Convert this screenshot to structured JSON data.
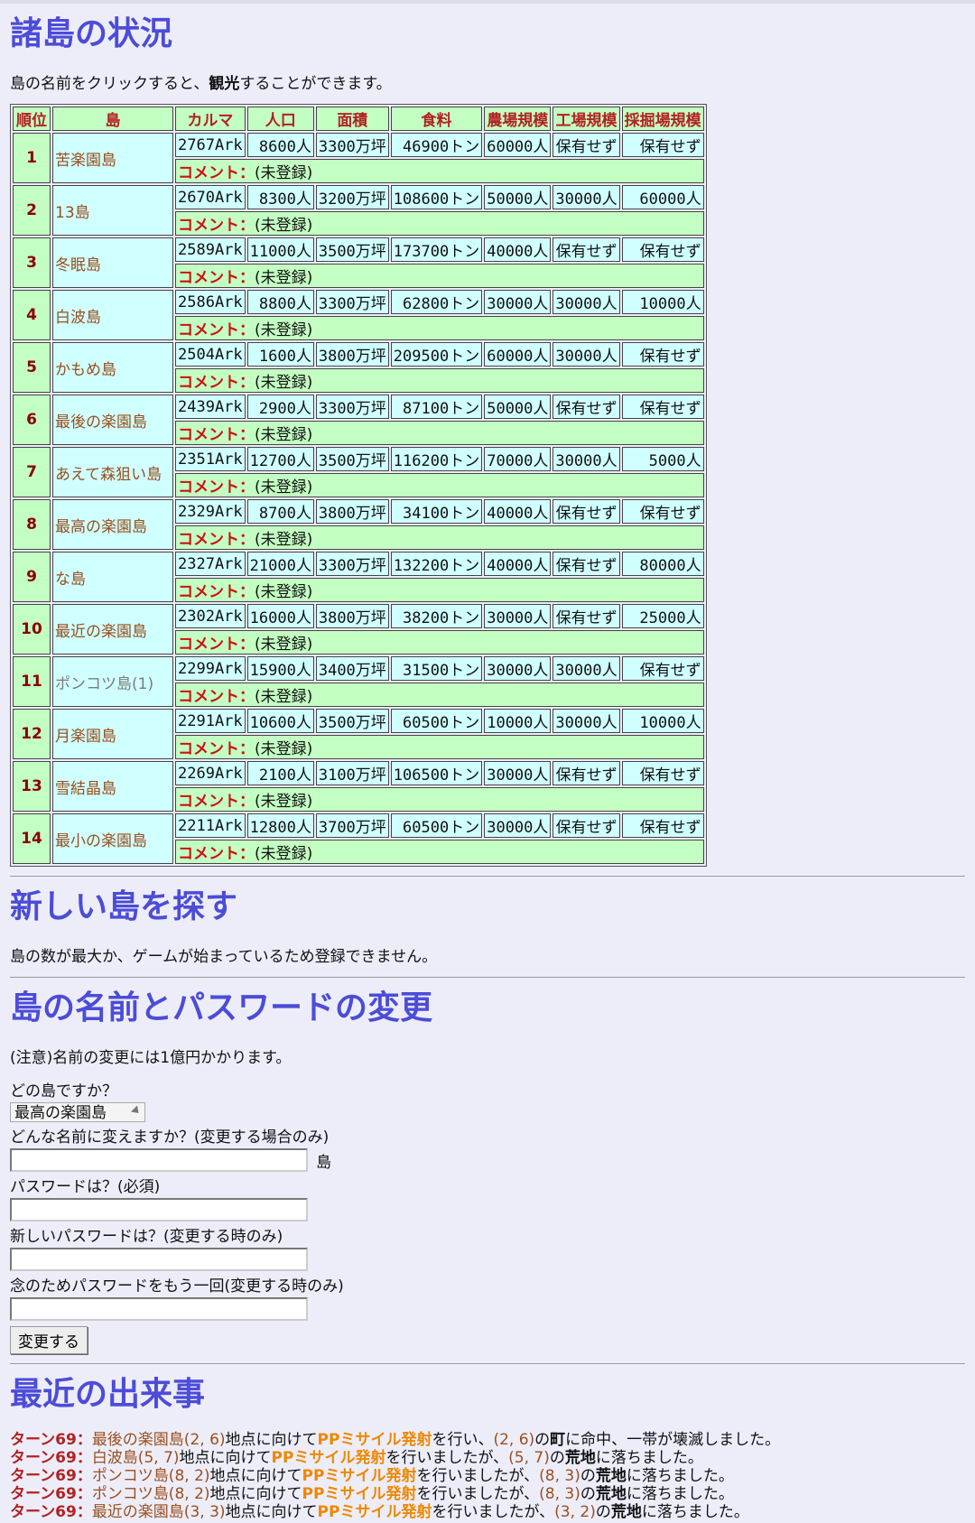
{
  "status": {
    "title": "諸島の状況",
    "note_pre": "島の名前をクリックすると、",
    "note_bold": "観光",
    "note_post": "することができます。",
    "headers": [
      "順位",
      "島",
      "カルマ",
      "人口",
      "面積",
      "食料",
      "農場規模",
      "工場規模",
      "採掘場規模"
    ],
    "comment_label": "コメント：",
    "rows": [
      {
        "rank": "1",
        "name": "苦楽園島",
        "karma": "2767Ark",
        "pop": "8600人",
        "area": "3300万坪",
        "food": "46900トン",
        "farm": "60000人",
        "factory": "保有せず",
        "mine": "保有せず",
        "comment": "(未登録)"
      },
      {
        "rank": "2",
        "name": "13島",
        "karma": "2670Ark",
        "pop": "8300人",
        "area": "3200万坪",
        "food": "108600トン",
        "farm": "50000人",
        "factory": "30000人",
        "mine": "60000人",
        "comment": "(未登録)"
      },
      {
        "rank": "3",
        "name": "冬眠島",
        "karma": "2589Ark",
        "pop": "11000人",
        "area": "3500万坪",
        "food": "173700トン",
        "farm": "40000人",
        "factory": "保有せず",
        "mine": "保有せず",
        "comment": "(未登録)"
      },
      {
        "rank": "4",
        "name": "白波島",
        "karma": "2586Ark",
        "pop": "8800人",
        "area": "3300万坪",
        "food": "62800トン",
        "farm": "30000人",
        "factory": "30000人",
        "mine": "10000人",
        "comment": "(未登録)"
      },
      {
        "rank": "5",
        "name": "かもめ島",
        "karma": "2504Ark",
        "pop": "1600人",
        "area": "3800万坪",
        "food": "209500トン",
        "farm": "60000人",
        "factory": "30000人",
        "mine": "保有せず",
        "comment": "(未登録)"
      },
      {
        "rank": "6",
        "name": "最後の楽園島",
        "karma": "2439Ark",
        "pop": "2900人",
        "area": "3300万坪",
        "food": "87100トン",
        "farm": "50000人",
        "factory": "保有せず",
        "mine": "保有せず",
        "comment": "(未登録)"
      },
      {
        "rank": "7",
        "name": "あえて森狙い島",
        "karma": "2351Ark",
        "pop": "12700人",
        "area": "3500万坪",
        "food": "116200トン",
        "farm": "70000人",
        "factory": "30000人",
        "mine": "5000人",
        "comment": "(未登録)"
      },
      {
        "rank": "8",
        "name": "最高の楽園島",
        "karma": "2329Ark",
        "pop": "8700人",
        "area": "3800万坪",
        "food": "34100トン",
        "farm": "40000人",
        "factory": "保有せず",
        "mine": "保有せず",
        "comment": "(未登録)"
      },
      {
        "rank": "9",
        "name": "な島",
        "karma": "2327Ark",
        "pop": "21000人",
        "area": "3300万坪",
        "food": "132200トン",
        "farm": "40000人",
        "factory": "保有せず",
        "mine": "80000人",
        "comment": "(未登録)"
      },
      {
        "rank": "10",
        "name": "最近の楽園島",
        "karma": "2302Ark",
        "pop": "16000人",
        "area": "3800万坪",
        "food": "38200トン",
        "farm": "30000人",
        "factory": "保有せず",
        "mine": "25000人",
        "comment": "(未登録)"
      },
      {
        "rank": "11",
        "name": "ポンコツ島(1)",
        "karma": "2299Ark",
        "pop": "15900人",
        "area": "3400万坪",
        "food": "31500トン",
        "farm": "30000人",
        "factory": "30000人",
        "mine": "保有せず",
        "comment": "(未登録)"
      },
      {
        "rank": "12",
        "name": "月楽園島",
        "karma": "2291Ark",
        "pop": "10600人",
        "area": "3500万坪",
        "food": "60500トン",
        "farm": "10000人",
        "factory": "30000人",
        "mine": "10000人",
        "comment": "(未登録)"
      },
      {
        "rank": "13",
        "name": "雪結晶島",
        "karma": "2269Ark",
        "pop": "2100人",
        "area": "3100万坪",
        "food": "106500トン",
        "farm": "30000人",
        "factory": "保有せず",
        "mine": "保有せず",
        "comment": "(未登録)"
      },
      {
        "rank": "14",
        "name": "最小の楽園島",
        "karma": "2211Ark",
        "pop": "12800人",
        "area": "3700万坪",
        "food": "60500トン",
        "farm": "30000人",
        "factory": "保有せず",
        "mine": "保有せず",
        "comment": "(未登録)"
      }
    ]
  },
  "new_island": {
    "title": "新しい島を探す",
    "message": "島の数が最大か、ゲームが始まっているため登録できません。"
  },
  "change": {
    "title": "島の名前とパスワードの変更",
    "note": "(注意)名前の変更には1億円かかります。",
    "which_label": "どの島ですか？",
    "selected_island": "最高の楽園島",
    "name_label": "どんな名前に変えますか？(変更する場合のみ)",
    "name_suffix": "島",
    "name_value": "",
    "password_label": "パスワードは？(必須)",
    "new_password_label": "新しいパスワードは？(変更する時のみ)",
    "confirm_label": "念のためパスワードをもう一回(変更する時のみ)",
    "submit": "変更する"
  },
  "events": {
    "title": "最近の出来事",
    "items": [
      {
        "turn": "ターン69",
        "sep": "：",
        "island": "最後の楽園島(2, 6)",
        "t1": "地点に向けて",
        "missile": "PPミサイル発射",
        "t2": "を行い、",
        "hit": "(2, 6)",
        "t3": "の",
        "target": "町",
        "t4": "に命中、一帯が壊滅しました。"
      },
      {
        "turn": "ターン69",
        "sep": "：",
        "island": "白波島(5, 7)",
        "t1": "地点に向けて",
        "missile": "PPミサイル発射",
        "t2": "を行いましたが、",
        "hit": "(5, 7)",
        "t3": "の",
        "target": "荒地",
        "t4": "に落ちました。"
      },
      {
        "turn": "ターン69",
        "sep": "：",
        "island": "ポンコツ島(8, 2)",
        "t1": "地点に向けて",
        "missile": "PPミサイル発射",
        "t2": "を行いましたが、",
        "hit": "(8, 3)",
        "t3": "の",
        "target": "荒地",
        "t4": "に落ちました。"
      },
      {
        "turn": "ターン69",
        "sep": "：",
        "island": "ポンコツ島(8, 2)",
        "t1": "地点に向けて",
        "missile": "PPミサイル発射",
        "t2": "を行いましたが、",
        "hit": "(8, 3)",
        "t3": "の",
        "target": "荒地",
        "t4": "に落ちました。"
      },
      {
        "turn": "ターン69",
        "sep": "：",
        "island": "最近の楽園島(3, 3)",
        "t1": "地点に向けて",
        "missile": "PPミサイル発射",
        "t2": "を行いましたが、",
        "hit": "(3, 2)",
        "t3": "の",
        "target": "荒地",
        "t4": "に落ちました。"
      }
    ]
  }
}
